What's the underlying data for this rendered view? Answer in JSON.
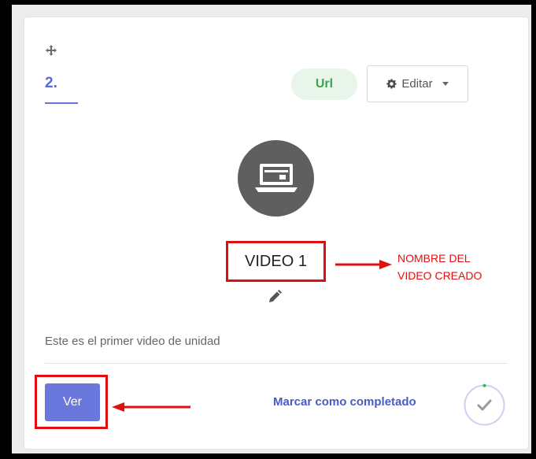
{
  "card": {
    "step_number": "2.",
    "type_badge": "Url",
    "edit_label": "Editar",
    "video_title": "VIDEO 1",
    "description": "Este es el primer video de unidad",
    "view_label": "Ver",
    "complete_label": "Marcar como completado"
  },
  "annotation": {
    "text": "NOMBRE DEL\nVIDEO CREADO"
  },
  "icons": {
    "move": "move-icon",
    "gear": "gear-icon",
    "caret": "caret-down-icon",
    "video": "laptop-video-icon",
    "edit": "pencil-icon",
    "check": "check-icon"
  },
  "colors": {
    "accent": "#5a6acf",
    "badge_bg": "#e7f5ea",
    "badge_text": "#3fa34d",
    "annotation_red": "#e01010",
    "circle_gray": "#5f5f5f"
  }
}
